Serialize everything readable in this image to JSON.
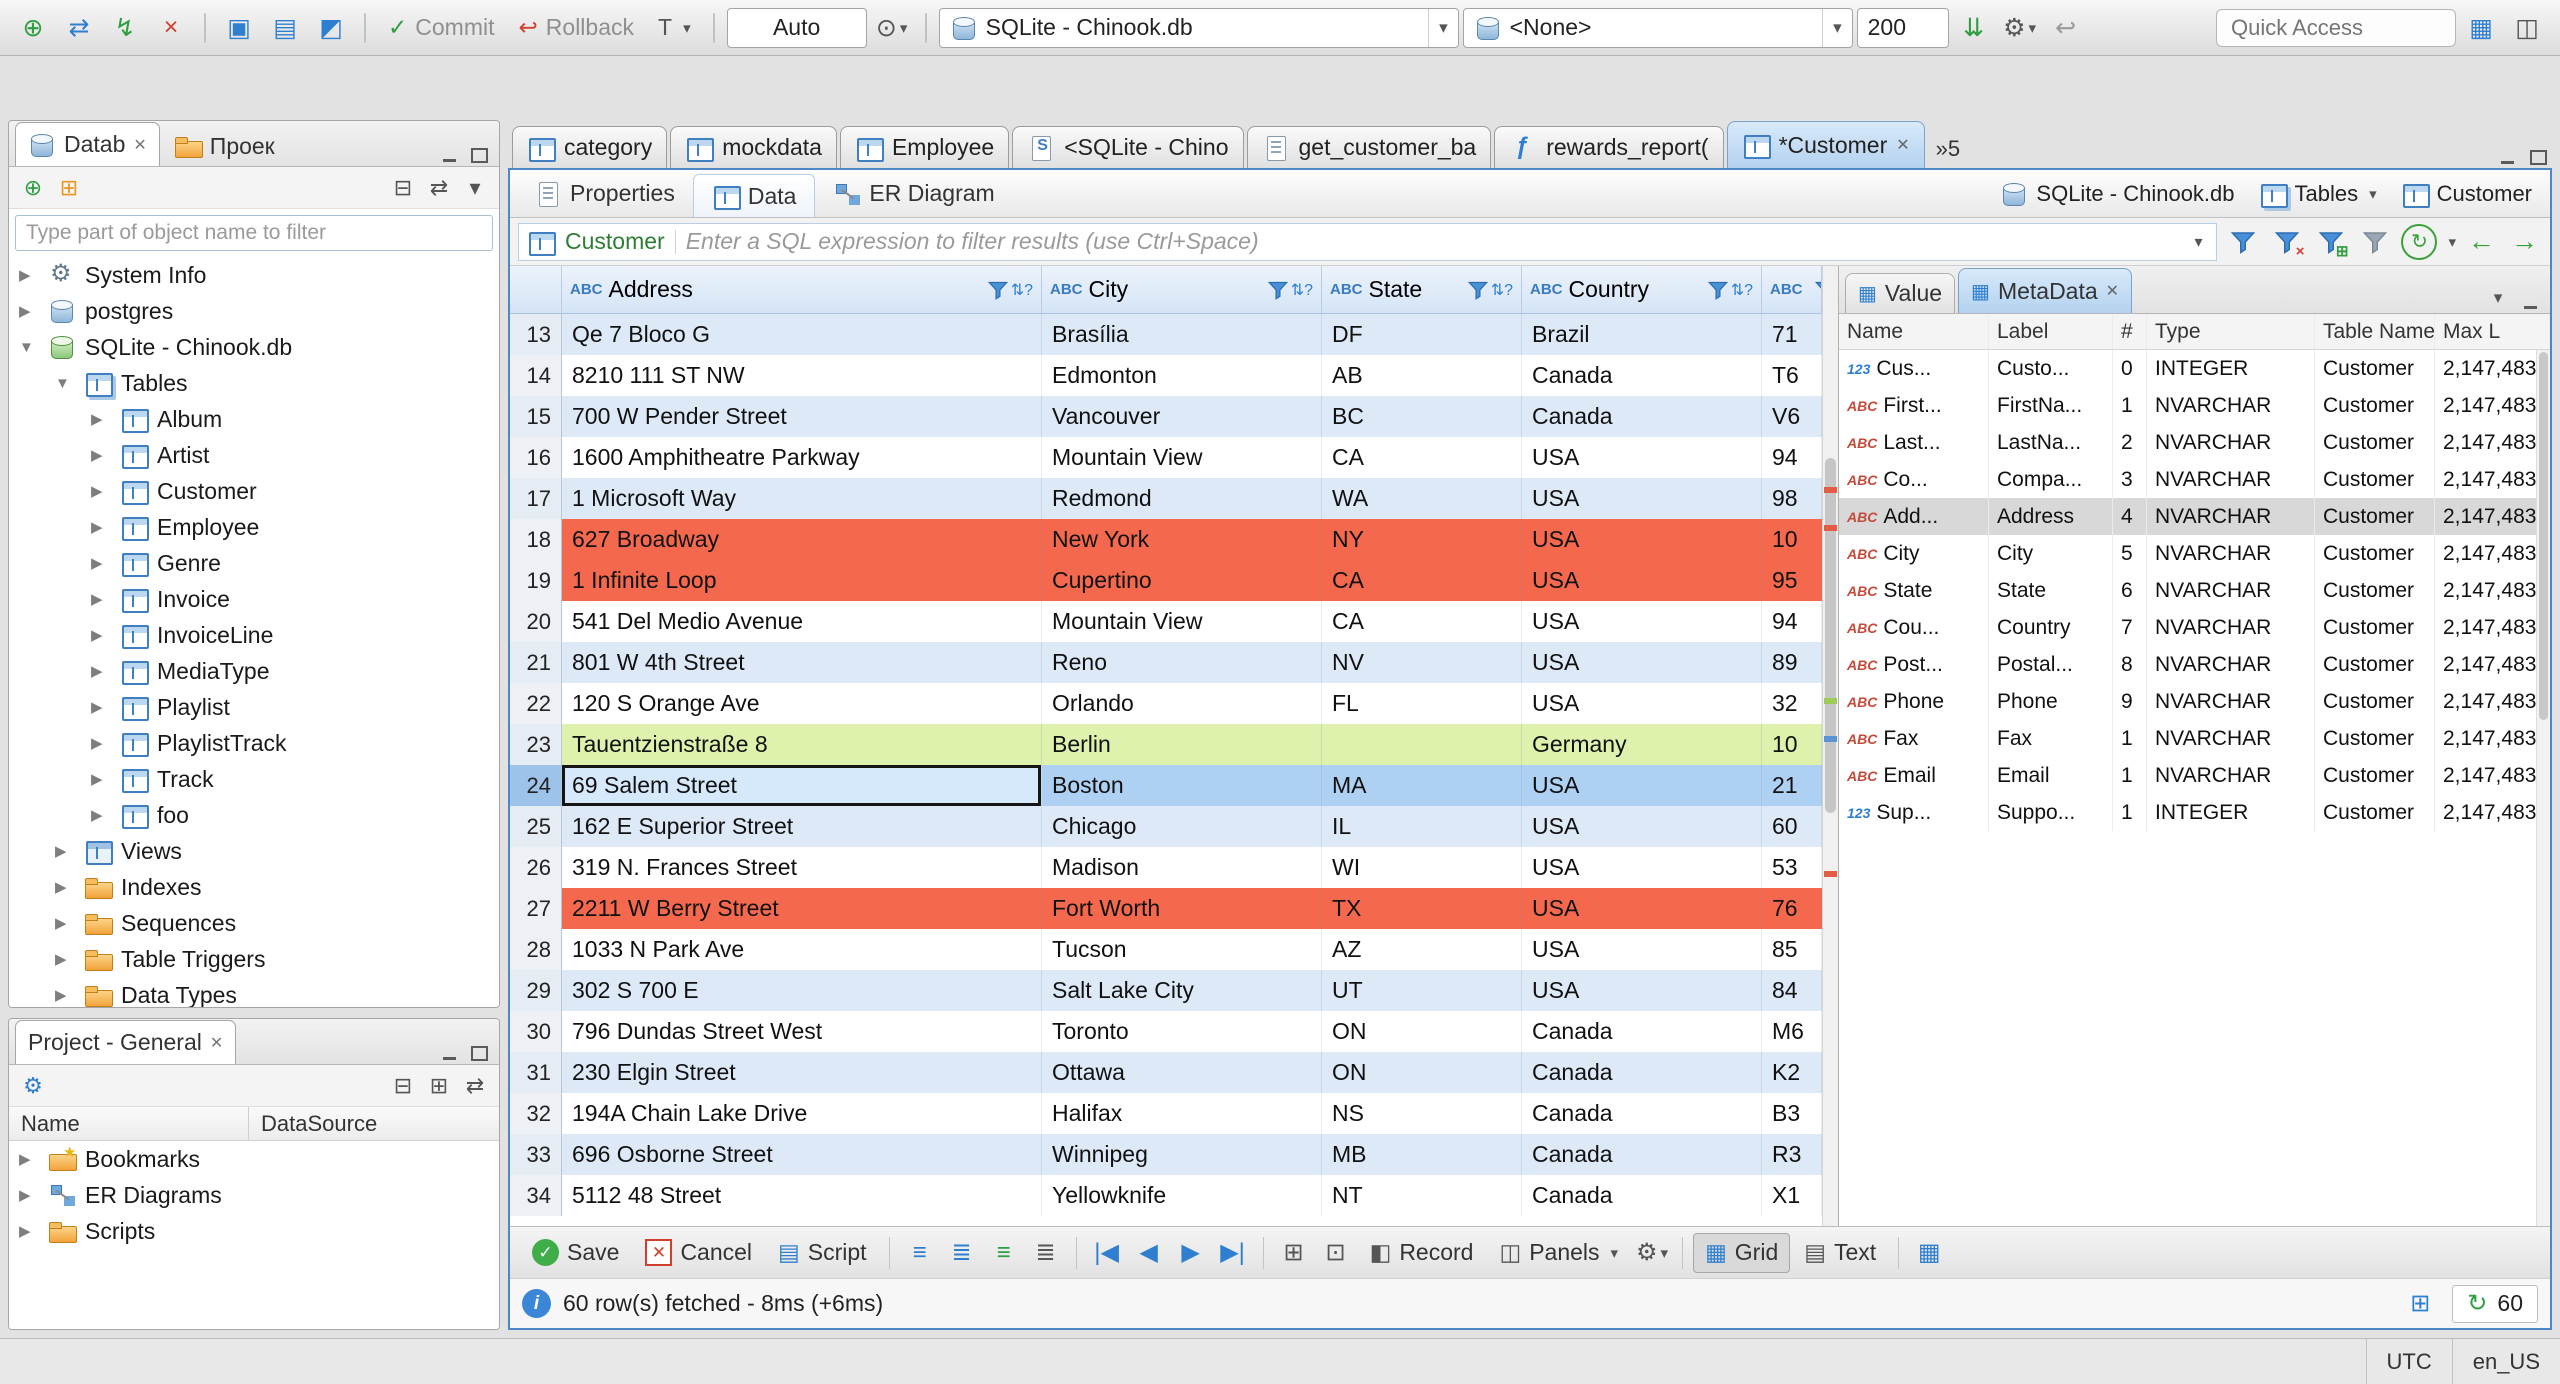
{
  "icons": {
    "caret": "▾",
    "sort": "⇅?",
    "close": "✕",
    "refresh": "↻",
    "info": "i",
    "first": "|◀",
    "prev": "◀",
    "next": "▶",
    "last": "▶|",
    "nav_left": "←",
    "nav_right": "→",
    "check": "✓",
    "cross": "×",
    "back": "↩",
    "gear": "⚙",
    "collapse": "⊟",
    "expandbox": "⊞",
    "link": "⇄",
    "menu": "▾",
    "grid_small": "▦",
    "text_small": "▤",
    "record": "◧",
    "panels": "◫",
    "justify_a": "≡",
    "justify_b": "≣",
    "pair_a": "⊞",
    "pair_b": "⊡",
    "clock": "⊙",
    "fetch": "⇊",
    "wand": "⚙",
    "persp_a": "▦",
    "persp_b": "◫",
    "txn": "T"
  },
  "toolbar": {
    "buttons": [
      {
        "name": "new-connection-icon",
        "glyph": "⊕",
        "cls": "c-green"
      },
      {
        "name": "reconnect-icon",
        "glyph": "⇄",
        "cls": "c-blue"
      },
      {
        "name": "connect-icon",
        "glyph": "↯",
        "cls": "c-green"
      },
      {
        "name": "disconnect-icon",
        "glyph": "×",
        "cls": "c-red"
      },
      {
        "name": "toolbar-separator",
        "glyph": "",
        "cls": "sep"
      },
      {
        "name": "sql-editor-icon",
        "glyph": "▣",
        "cls": "c-blue"
      },
      {
        "name": "sql-console-icon",
        "glyph": "▤",
        "cls": "c-blue"
      },
      {
        "name": "new-sql-editor-icon",
        "glyph": "◩",
        "cls": "c-blue"
      },
      {
        "name": "toolbar-separator",
        "glyph": "",
        "cls": "sep"
      }
    ],
    "commit": "Commit",
    "rollback": "Rollback",
    "auto": "Auto",
    "connection": "SQLite - Chinook.db",
    "schema": "<None>",
    "fetch_size": "200",
    "quick_access": "Quick Access"
  },
  "navigator": {
    "tab_db": "Datab",
    "tab_proj": "Проек",
    "filter_placeholder": "Type part of object name to filter",
    "toolbar": [
      {
        "name": "new-connection-icon",
        "glyph": "⊕",
        "cls": "c-green"
      },
      {
        "name": "new-folder-icon",
        "glyph": "⊞",
        "cls": "c-orange"
      },
      {
        "name": "toolbar-spacer",
        "glyph": "",
        "cls": "spacer"
      },
      {
        "name": "collapse-all-icon",
        "glyph": "⊟",
        "cls": "c-dark"
      },
      {
        "name": "link-with-editor-icon",
        "glyph": "⇄",
        "cls": "c-dark"
      },
      {
        "name": "view-menu-icon",
        "glyph": "▾",
        "cls": "c-dark"
      }
    ],
    "tree": [
      {
        "arrow": "▶",
        "icon": "gear",
        "label": "System Info",
        "lvl": "lvl0",
        "cls": ""
      },
      {
        "arrow": "▶",
        "icon": "db",
        "label": "postgres",
        "lvl": "lvl0",
        "cls": ""
      },
      {
        "arrow": "▼",
        "icon": "dbg",
        "label": "SQLite - Chinook.db",
        "lvl": "lvl0",
        "cls": ""
      },
      {
        "arrow": "▼",
        "icon": "tables",
        "label": "Tables",
        "lvl": "lvl1",
        "cls": ""
      },
      {
        "arrow": "▶",
        "icon": "table",
        "label": "Album",
        "lvl": "lvl2",
        "cls": ""
      },
      {
        "arrow": "▶",
        "icon": "table",
        "label": "Artist",
        "lvl": "lvl2",
        "cls": ""
      },
      {
        "arrow": "▶",
        "icon": "table",
        "label": "Customer",
        "lvl": "lvl2",
        "cls": "sel"
      },
      {
        "arrow": "▶",
        "icon": "table",
        "label": "Employee",
        "lvl": "lvl2",
        "cls": ""
      },
      {
        "arrow": "▶",
        "icon": "table",
        "label": "Genre",
        "lvl": "lvl2",
        "cls": ""
      },
      {
        "arrow": "▶",
        "icon": "table",
        "label": "Invoice",
        "lvl": "lvl2",
        "cls": ""
      },
      {
        "arrow": "▶",
        "icon": "table",
        "label": "InvoiceLine",
        "lvl": "lvl2",
        "cls": ""
      },
      {
        "arrow": "▶",
        "icon": "table",
        "label": "MediaType",
        "lvl": "lvl2",
        "cls": ""
      },
      {
        "arrow": "▶",
        "icon": "table",
        "label": "Playlist",
        "lvl": "lvl2",
        "cls": ""
      },
      {
        "arrow": "▶",
        "icon": "table",
        "label": "PlaylistTrack",
        "lvl": "lvl2",
        "cls": ""
      },
      {
        "arrow": "▶",
        "icon": "table",
        "label": "Track",
        "lvl": "lvl2",
        "cls": ""
      },
      {
        "arrow": "▶",
        "icon": "table",
        "label": "foo",
        "lvl": "lvl2",
        "cls": ""
      },
      {
        "arrow": "▶",
        "icon": "view",
        "label": "Views",
        "lvl": "lvl1",
        "cls": ""
      },
      {
        "arrow": "▶",
        "icon": "folder",
        "label": "Indexes",
        "lvl": "lvl1",
        "cls": ""
      },
      {
        "arrow": "▶",
        "icon": "folder",
        "label": "Sequences",
        "lvl": "lvl1",
        "cls": ""
      },
      {
        "arrow": "▶",
        "icon": "folder",
        "label": "Table Triggers",
        "lvl": "lvl1",
        "cls": ""
      },
      {
        "arrow": "▶",
        "icon": "folder",
        "label": "Data Types",
        "lvl": "lvl1",
        "cls": ""
      }
    ]
  },
  "project": {
    "tab": "Project - General",
    "col_name": "Name",
    "col_ds": "DataSource",
    "toolbar": [
      {
        "name": "project-settings-icon",
        "glyph": "⚙",
        "cls": "c-blue"
      },
      {
        "name": "toolbar-spacer",
        "glyph": "",
        "cls": "spacer"
      },
      {
        "name": "collapse-all-icon",
        "glyph": "⊟",
        "cls": "c-dark"
      },
      {
        "name": "expand-all-icon",
        "glyph": "⊞",
        "cls": "c-dark"
      },
      {
        "name": "link-with-editor-icon",
        "glyph": "⇄",
        "cls": "c-dark"
      }
    ],
    "items": [
      {
        "arrow": "▶",
        "icon": "bookmarks",
        "label": "Bookmarks"
      },
      {
        "arrow": "▶",
        "icon": "erd",
        "label": "ER Diagrams"
      },
      {
        "arrow": "▶",
        "icon": "folder",
        "label": "Scripts"
      }
    ]
  },
  "editor": {
    "tabs": [
      {
        "label": "category",
        "icon": "table",
        "cls": "",
        "close": "",
        "icon_glyph": ""
      },
      {
        "label": "mockdata",
        "icon": "table",
        "cls": "",
        "close": "",
        "icon_glyph": ""
      },
      {
        "label": "Employee",
        "icon": "table",
        "cls": "",
        "close": "",
        "icon_glyph": ""
      },
      {
        "label": "<SQLite - Chino",
        "icon": "sqlpage",
        "cls": "",
        "close": "",
        "icon_glyph": ""
      },
      {
        "label": "get_customer_ba",
        "icon": "script",
        "cls": "",
        "close": "",
        "icon_glyph": ""
      },
      {
        "label": "rewards_report(",
        "icon": "func",
        "cls": "",
        "close": "",
        "icon_glyph": "ƒ"
      },
      {
        "label": "*Customer",
        "icon": "table",
        "cls": "active",
        "close": "✕",
        "icon_glyph": ""
      }
    ],
    "overflow": "»5",
    "subtabs": [
      {
        "label": "Properties",
        "icon": "props",
        "cls": ""
      },
      {
        "label": "Data",
        "icon": "table",
        "cls": "active"
      },
      {
        "label": "ER Diagram",
        "icon": "erd",
        "cls": ""
      }
    ],
    "context": {
      "connection": "SQLite - Chinook.db",
      "container": "Tables",
      "object": "Customer"
    },
    "filter": {
      "table": "Customer",
      "placeholder": "Enter a SQL expression to filter results (use Ctrl+Space)"
    }
  },
  "grid": {
    "columns": [
      {
        "type_icon": "ABC",
        "name": "Address",
        "w": "c-addr"
      },
      {
        "type_icon": "ABC",
        "name": "City",
        "w": "c-city"
      },
      {
        "type_icon": "ABC",
        "name": "State",
        "w": "c-state"
      },
      {
        "type_icon": "ABC",
        "name": "Country",
        "w": "c-country"
      },
      {
        "type_icon": "ABC",
        "name": "",
        "w": "c-postal"
      }
    ],
    "rows": [
      {
        "num": "13",
        "address": "Qe 7 Bloco G",
        "city": "Brasília",
        "state": "DF",
        "country": "Brazil",
        "postal": "71",
        "cls": "alt"
      },
      {
        "num": "14",
        "address": "8210 111 ST NW",
        "city": "Edmonton",
        "state": "AB",
        "country": "Canada",
        "postal": "T6",
        "cls": ""
      },
      {
        "num": "15",
        "address": "700 W Pender Street",
        "city": "Vancouver",
        "state": "BC",
        "country": "Canada",
        "postal": "V6",
        "cls": "alt"
      },
      {
        "num": "16",
        "address": "1600 Amphitheatre Parkway",
        "city": "Mountain View",
        "state": "CA",
        "country": "USA",
        "postal": "94",
        "cls": ""
      },
      {
        "num": "17",
        "address": "1 Microsoft Way",
        "city": "Redmond",
        "state": "WA",
        "country": "USA",
        "postal": "98",
        "cls": "alt"
      },
      {
        "num": "18",
        "address": "627 Broadway",
        "city": "New York",
        "state": "NY",
        "country": "USA",
        "postal": "10",
        "cls": "red"
      },
      {
        "num": "19",
        "address": "1 Infinite Loop",
        "city": "Cupertino",
        "state": "CA",
        "country": "USA",
        "postal": "95",
        "cls": "red"
      },
      {
        "num": "20",
        "address": "541 Del Medio Avenue",
        "city": "Mountain View",
        "state": "CA",
        "country": "USA",
        "postal": "94",
        "cls": ""
      },
      {
        "num": "21",
        "address": "801 W 4th Street",
        "city": "Reno",
        "state": "NV",
        "country": "USA",
        "postal": "89",
        "cls": "alt"
      },
      {
        "num": "22",
        "address": "120 S Orange Ave",
        "city": "Orlando",
        "state": "FL",
        "country": "USA",
        "postal": "32",
        "cls": ""
      },
      {
        "num": "23",
        "address": "Tauentzienstraße 8",
        "city": "Berlin",
        "state": "",
        "country": "Germany",
        "postal": "10",
        "cls": "green"
      },
      {
        "num": "24",
        "address": "69 Salem Street",
        "city": "Boston",
        "state": "MA",
        "country": "USA",
        "postal": "21",
        "cls": "sel"
      },
      {
        "num": "25",
        "address": "162 E Superior Street",
        "city": "Chicago",
        "state": "IL",
        "country": "USA",
        "postal": "60",
        "cls": "alt"
      },
      {
        "num": "26",
        "address": "319 N. Frances Street",
        "city": "Madison",
        "state": "WI",
        "country": "USA",
        "postal": "53",
        "cls": ""
      },
      {
        "num": "27",
        "address": "2211 W Berry Street",
        "city": "Fort Worth",
        "state": "TX",
        "country": "USA",
        "postal": "76",
        "cls": "red"
      },
      {
        "num": "28",
        "address": "1033 N Park Ave",
        "city": "Tucson",
        "state": "AZ",
        "country": "USA",
        "postal": "85",
        "cls": ""
      },
      {
        "num": "29",
        "address": "302 S 700 E",
        "city": "Salt Lake City",
        "state": "UT",
        "country": "USA",
        "postal": "84",
        "cls": "alt"
      },
      {
        "num": "30",
        "address": "796 Dundas Street West",
        "city": "Toronto",
        "state": "ON",
        "country": "Canada",
        "postal": "M6",
        "cls": ""
      },
      {
        "num": "31",
        "address": "230 Elgin Street",
        "city": "Ottawa",
        "state": "ON",
        "country": "Canada",
        "postal": "K2",
        "cls": "alt"
      },
      {
        "num": "32",
        "address": "194A Chain Lake Drive",
        "city": "Halifax",
        "state": "NS",
        "country": "Canada",
        "postal": "B3",
        "cls": ""
      },
      {
        "num": "33",
        "address": "696 Osborne Street",
        "city": "Winnipeg",
        "state": "MB",
        "country": "Canada",
        "postal": "R3",
        "cls": "alt"
      },
      {
        "num": "34",
        "address": "5112 48 Street",
        "city": "Yellowknife",
        "state": "NT",
        "country": "Canada",
        "postal": "X1",
        "cls": ""
      }
    ]
  },
  "panel": {
    "tab_value": "Value",
    "tab_meta": "MetaData",
    "columns": [
      "Name",
      "Label",
      "#",
      "Type",
      "Table Name",
      "Max L"
    ],
    "rows": [
      {
        "tico": "123",
        "ticocls": "int",
        "name": "Cus...",
        "label": "Custo...",
        "num": "0",
        "type": "INTEGER",
        "table": "Customer",
        "max": "2,147,483",
        "cls": ""
      },
      {
        "tico": "ABC",
        "ticocls": "str",
        "name": "First...",
        "label": "FirstNa...",
        "num": "1",
        "type": "NVARCHAR",
        "table": "Customer",
        "max": "2,147,483",
        "cls": ""
      },
      {
        "tico": "ABC",
        "ticocls": "str",
        "name": "Last...",
        "label": "LastNa...",
        "num": "2",
        "type": "NVARCHAR",
        "table": "Customer",
        "max": "2,147,483",
        "cls": ""
      },
      {
        "tico": "ABC",
        "ticocls": "str",
        "name": "Co...",
        "label": "Compa...",
        "num": "3",
        "type": "NVARCHAR",
        "table": "Customer",
        "max": "2,147,483",
        "cls": ""
      },
      {
        "tico": "ABC",
        "ticocls": "str",
        "name": "Add...",
        "label": "Address",
        "num": "4",
        "type": "NVARCHAR",
        "table": "Customer",
        "max": "2,147,483",
        "cls": "sel"
      },
      {
        "tico": "ABC",
        "ticocls": "str",
        "name": "City",
        "label": "City",
        "num": "5",
        "type": "NVARCHAR",
        "table": "Customer",
        "max": "2,147,483",
        "cls": ""
      },
      {
        "tico": "ABC",
        "ticocls": "str",
        "name": "State",
        "label": "State",
        "num": "6",
        "type": "NVARCHAR",
        "table": "Customer",
        "max": "2,147,483",
        "cls": ""
      },
      {
        "tico": "ABC",
        "ticocls": "str",
        "name": "Cou...",
        "label": "Country",
        "num": "7",
        "type": "NVARCHAR",
        "table": "Customer",
        "max": "2,147,483",
        "cls": ""
      },
      {
        "tico": "ABC",
        "ticocls": "str",
        "name": "Post...",
        "label": "Postal...",
        "num": "8",
        "type": "NVARCHAR",
        "table": "Customer",
        "max": "2,147,483",
        "cls": ""
      },
      {
        "tico": "ABC",
        "ticocls": "str",
        "name": "Phone",
        "label": "Phone",
        "num": "9",
        "type": "NVARCHAR",
        "table": "Customer",
        "max": "2,147,483",
        "cls": ""
      },
      {
        "tico": "ABC",
        "ticocls": "str",
        "name": "Fax",
        "label": "Fax",
        "num": "1",
        "type": "NVARCHAR",
        "table": "Customer",
        "max": "2,147,483",
        "cls": ""
      },
      {
        "tico": "ABC",
        "ticocls": "str",
        "name": "Email",
        "label": "Email",
        "num": "1",
        "type": "NVARCHAR",
        "table": "Customer",
        "max": "2,147,483",
        "cls": ""
      },
      {
        "tico": "123",
        "ticocls": "int",
        "name": "Sup...",
        "label": "Suppo...",
        "num": "1",
        "type": "INTEGER",
        "table": "Customer",
        "max": "2,147,483",
        "cls": ""
      }
    ]
  },
  "bottombar": {
    "save": "Save",
    "cancel": "Cancel",
    "script": "Script",
    "record": "Record",
    "panels": "Panels",
    "grid": "Grid",
    "text": "Text"
  },
  "statusrow": {
    "message": "60 row(s) fetched - 8ms (+6ms)",
    "refresh_count": "60"
  },
  "statusbar": {
    "tz": "UTC",
    "locale": "en_US"
  }
}
